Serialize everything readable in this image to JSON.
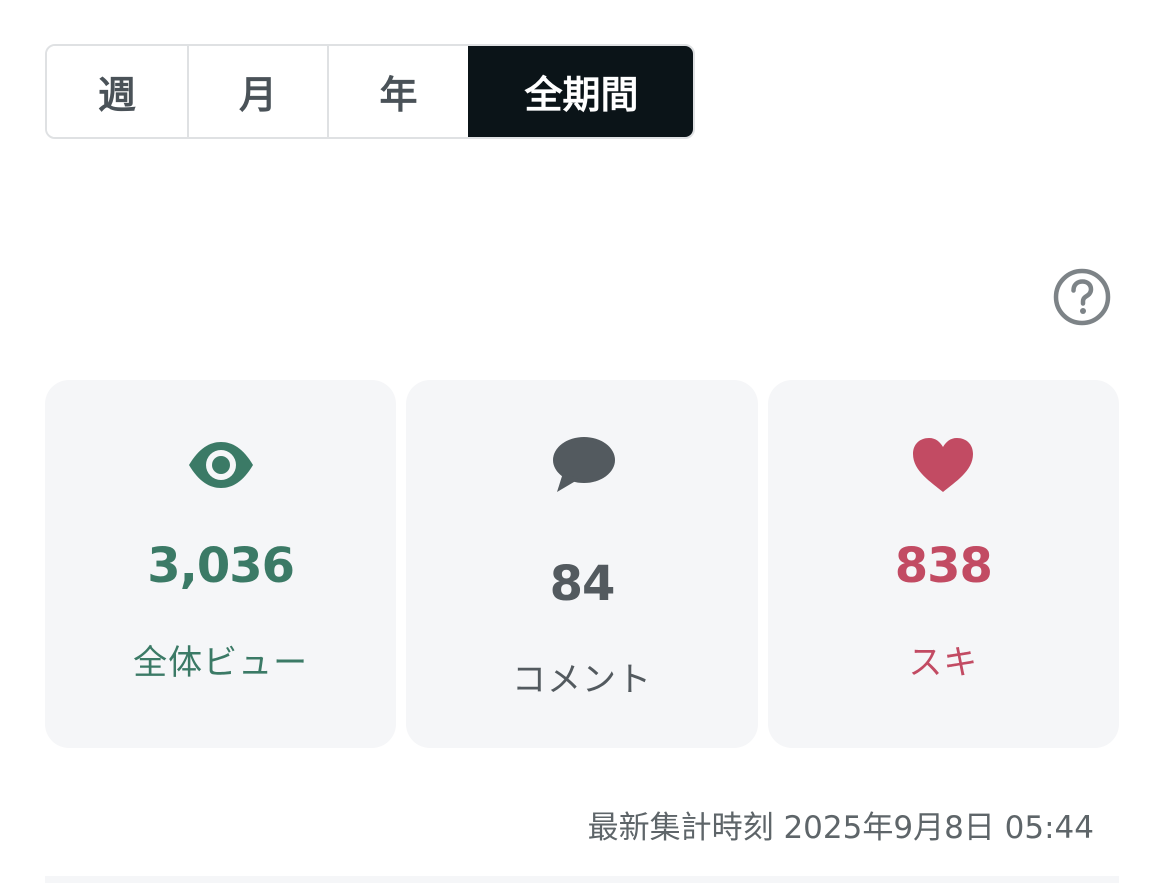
{
  "period_tabs": [
    {
      "label": "週",
      "active": false
    },
    {
      "label": "月",
      "active": false
    },
    {
      "label": "年",
      "active": false
    },
    {
      "label": "全期間",
      "active": true
    }
  ],
  "help": {
    "icon": "question-circle-icon"
  },
  "stats": {
    "views": {
      "icon": "eye-icon",
      "value": "3,036",
      "label": "全体ビュー",
      "color": "#3b7a66"
    },
    "comments": {
      "icon": "speech-bubble-icon",
      "value": "84",
      "label": "コメント",
      "color": "#535a5f"
    },
    "likes": {
      "icon": "heart-icon",
      "value": "838",
      "label": "スキ",
      "color": "#c24b63"
    }
  },
  "updated_at": "最新集計時刻 2025年9月8日 05:44"
}
